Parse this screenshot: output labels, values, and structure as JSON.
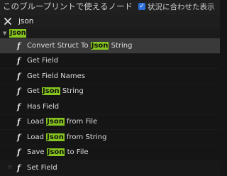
{
  "header": {
    "title": "このブループリントで使えるノード",
    "context_label": "状況に合わせた表示",
    "context_checked": true
  },
  "search": {
    "value": "json"
  },
  "category": {
    "label": "Json"
  },
  "items": [
    {
      "parts": [
        "Convert Struct To ",
        "Json",
        " String"
      ],
      "selected": true
    },
    {
      "parts": [
        "Get Field",
        "",
        ""
      ]
    },
    {
      "parts": [
        "Get Field Names",
        "",
        ""
      ]
    },
    {
      "parts": [
        "Get ",
        "Json",
        " String"
      ]
    },
    {
      "parts": [
        "Has Field",
        "",
        ""
      ]
    },
    {
      "parts": [
        "Load ",
        "Json",
        " from File"
      ]
    },
    {
      "parts": [
        "Load ",
        "Json",
        " from String"
      ]
    },
    {
      "parts": [
        "Save ",
        "Json",
        " to File"
      ]
    },
    {
      "parts": [
        "Set Field",
        "",
        ""
      ]
    }
  ],
  "icons": {
    "function": "function-icon",
    "clear": "clear-search-icon",
    "expand": "expand-arrow-icon",
    "favorite": "star-icon"
  },
  "colors": {
    "highlight": "#86c41e",
    "selected_row": "#3a3a3a",
    "checkbox": "#2c6fd8"
  }
}
